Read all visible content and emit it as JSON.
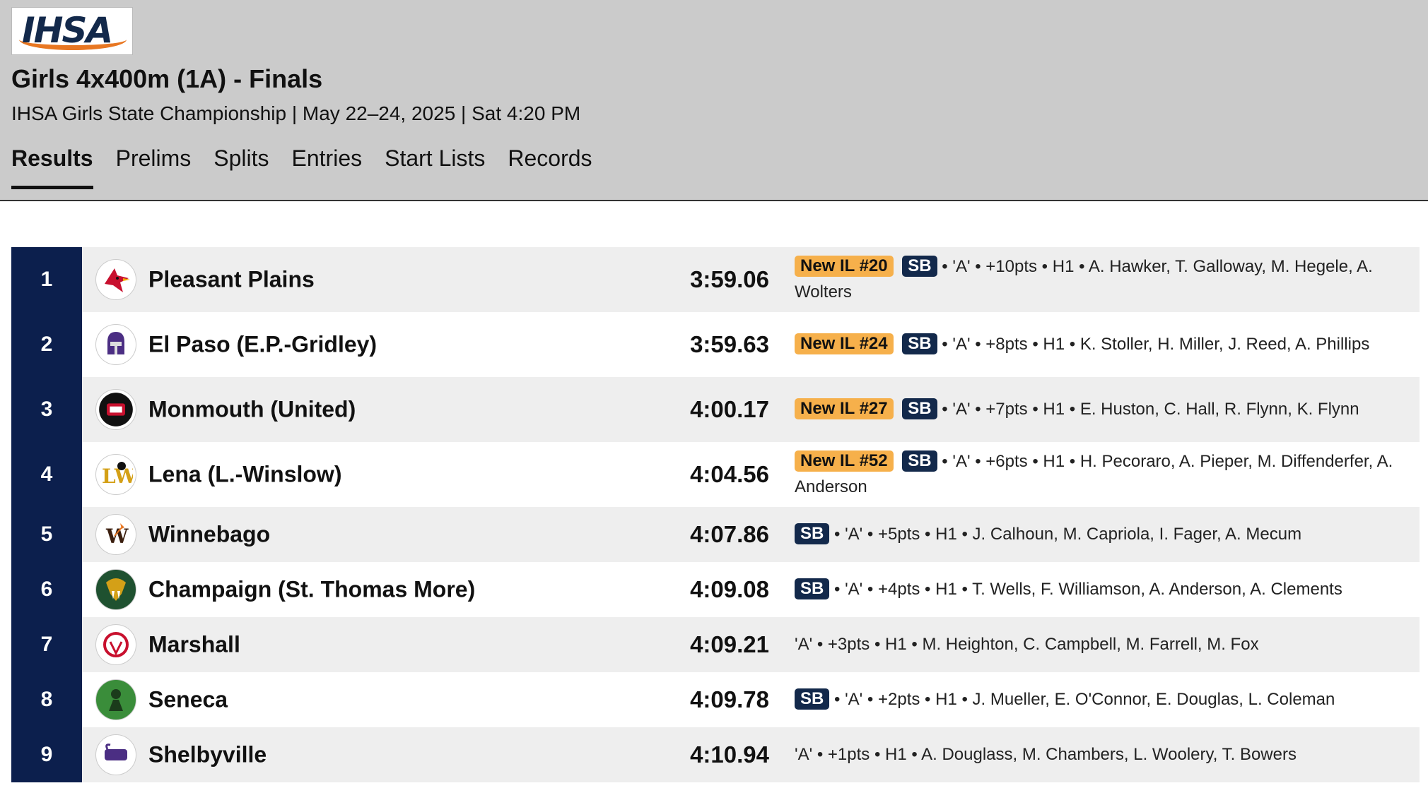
{
  "brand": {
    "logo_text": "IHSA",
    "navy": "#13294b",
    "orange": "#e87722"
  },
  "event": {
    "title": "Girls 4x400m (1A) - Finals",
    "subtitle": "IHSA Girls State Championship | May 22–24, 2025 | Sat 4:20 PM"
  },
  "tabs": [
    {
      "label": "Results",
      "active": true
    },
    {
      "label": "Prelims"
    },
    {
      "label": "Splits"
    },
    {
      "label": "Entries"
    },
    {
      "label": "Start Lists"
    },
    {
      "label": "Records"
    }
  ],
  "results": [
    {
      "place": "1",
      "school": "Pleasant Plains",
      "logo_icon": "cardinal-icon",
      "mark": "3:59.06",
      "rank_badge": "New IL #20",
      "sb": "SB",
      "details": " • 'A' • +10pts • H1 • A. Hawker, T. Galloway, M. Hegele, A. Wolters"
    },
    {
      "place": "2",
      "school": "El Paso (E.P.-Gridley)",
      "logo_icon": "titan-helmet-icon",
      "mark": "3:59.63",
      "rank_badge": "New IL #24",
      "sb": "SB",
      "details": " • 'A' • +8pts • H1 • K. Stoller, H. Miller, J. Reed, A. Phillips"
    },
    {
      "place": "3",
      "school": "Monmouth (United)",
      "logo_icon": "red-storm-icon",
      "mark": "4:00.17",
      "rank_badge": "New IL #27",
      "sb": "SB",
      "details": " • 'A' • +7pts • H1 • E. Huston, C. Hall, R. Flynn, K. Flynn"
    },
    {
      "place": "4",
      "school": "Lena (L.-Winslow)",
      "logo_icon": "lw-panther-icon",
      "mark": "4:04.56",
      "rank_badge": "New IL #52",
      "sb": "SB",
      "details": " • 'A' • +6pts • H1 • H. Pecoraro, A. Pieper, M. Diffenderfer, A. Anderson"
    },
    {
      "place": "5",
      "school": "Winnebago",
      "logo_icon": "w-arrow-icon",
      "mark": "4:07.86",
      "rank_badge": "",
      "sb": "SB",
      "details": " • 'A' • +5pts • H1 • J. Calhoun, M. Capriola, I. Fager, A. Mecum"
    },
    {
      "place": "6",
      "school": "Champaign (St. Thomas More)",
      "logo_icon": "sabertooth-icon",
      "mark": "4:09.08",
      "rank_badge": "",
      "sb": "SB",
      "details": " • 'A' • +4pts • H1 • T. Wells, F. Williamson, A. Anderson, A. Clements"
    },
    {
      "place": "7",
      "school": "Marshall",
      "logo_icon": "lion-icon",
      "mark": "4:09.21",
      "rank_badge": "",
      "sb": "",
      "details": "'A' • +3pts • H1 • M. Heighton, C. Campbell, M. Farrell, M. Fox"
    },
    {
      "place": "8",
      "school": "Seneca",
      "logo_icon": "fighting-irish-icon",
      "mark": "4:09.78",
      "rank_badge": "",
      "sb": "SB",
      "details": " • 'A' • +2pts • H1 • J. Mueller, E. O'Connor, E. Douglas, L. Coleman"
    },
    {
      "place": "9",
      "school": "Shelbyville",
      "logo_icon": "rams-icon",
      "mark": "4:10.94",
      "rank_badge": "",
      "sb": "",
      "details": "'A' • +1pts • H1 • A. Douglass, M. Chambers, L. Woolery, T. Bowers"
    }
  ]
}
